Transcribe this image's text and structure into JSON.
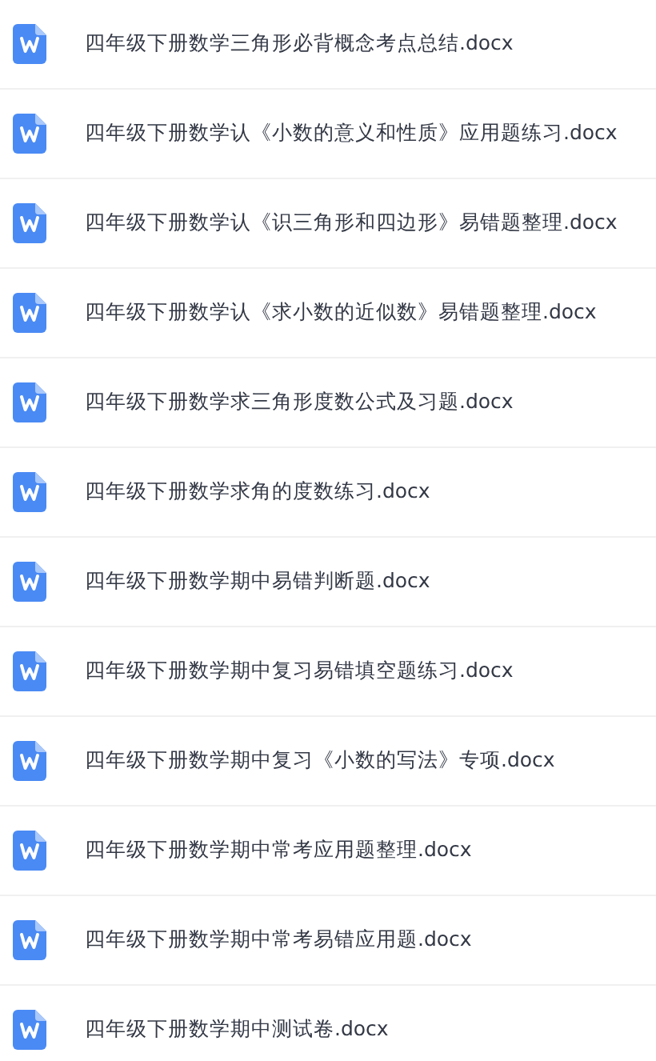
{
  "files": [
    {
      "name": "四年级下册数学三角形必背概念考点总结.docx"
    },
    {
      "name": "四年级下册数学认《小数的意义和性质》应用题练习.docx"
    },
    {
      "name": "四年级下册数学认《识三角形和四边形》易错题整理.docx"
    },
    {
      "name": "四年级下册数学认《求小数的近似数》易错题整理.docx"
    },
    {
      "name": "四年级下册数学求三角形度数公式及习题.docx"
    },
    {
      "name": "四年级下册数学求角的度数练习.docx"
    },
    {
      "name": "四年级下册数学期中易错判断题.docx"
    },
    {
      "name": "四年级下册数学期中复习易错填空题练习.docx"
    },
    {
      "name": "四年级下册数学期中复习《小数的写法》专项.docx"
    },
    {
      "name": "四年级下册数学期中常考应用题整理.docx"
    },
    {
      "name": "四年级下册数学期中常考易错应用题.docx"
    },
    {
      "name": "四年级下册数学期中测试卷.docx"
    }
  ]
}
